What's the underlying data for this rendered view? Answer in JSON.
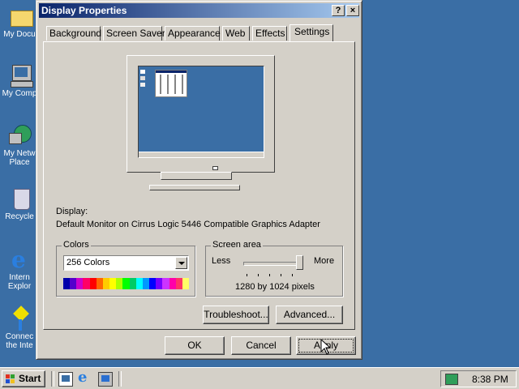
{
  "desktop": {
    "icons": [
      {
        "label": "My Docu"
      },
      {
        "label": "My Comp"
      },
      {
        "label": "My Netw",
        "label2": "Place"
      },
      {
        "label": "Recycle"
      },
      {
        "label": "Intern",
        "label2": "Explor"
      },
      {
        "label": "Connec",
        "label2": "the Inte"
      }
    ]
  },
  "window": {
    "title": "Display Properties",
    "help_label": "?",
    "close_label": "×",
    "tabs": [
      "Background",
      "Screen Saver",
      "Appearance",
      "Web",
      "Effects",
      "Settings"
    ],
    "active_tab": "Settings",
    "display_label": "Display:",
    "display_value": "Default Monitor on Cirrus Logic 5446 Compatible Graphics Adapter",
    "colors": {
      "legend": "Colors",
      "selected": "256 Colors",
      "palette": [
        "#0000aa",
        "#5500cc",
        "#cc00cc",
        "#ff0066",
        "#ff0000",
        "#ff6600",
        "#ffcc00",
        "#ffff00",
        "#aaff00",
        "#00ff00",
        "#00cc66",
        "#00ffff",
        "#0099ff",
        "#0000ff",
        "#7700ff",
        "#cc33ff",
        "#ff00aa",
        "#ff3366",
        "#ffff66"
      ]
    },
    "screen_area": {
      "legend": "Screen area",
      "less_label": "Less",
      "more_label": "More",
      "resolution": "1280 by 1024 pixels",
      "slider_level": 1.0
    },
    "troubleshoot_label": "Troubleshoot...",
    "advanced_label": "Advanced...",
    "ok_label": "OK",
    "cancel_label": "Cancel",
    "apply_label": "Apply"
  },
  "taskbar": {
    "start_label": "Start",
    "clock": "8:38 PM"
  }
}
